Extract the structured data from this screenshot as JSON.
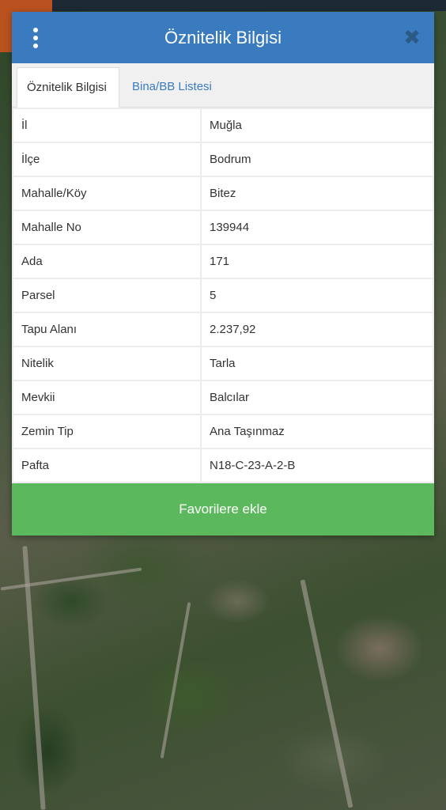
{
  "dialog": {
    "title": "Öznitelik Bilgisi",
    "menu_icon": "more-vertical-icon",
    "close_icon": "close-icon",
    "close_glyph": "✖"
  },
  "tabs": [
    {
      "label": "Öznitelik Bilgisi",
      "active": true
    },
    {
      "label": "Bina/BB Listesi",
      "active": false
    }
  ],
  "attributes": [
    {
      "key": "İl",
      "value": "Muğla"
    },
    {
      "key": "İlçe",
      "value": "Bodrum"
    },
    {
      "key": "Mahalle/Köy",
      "value": "Bitez"
    },
    {
      "key": "Mahalle No",
      "value": "139944"
    },
    {
      "key": "Ada",
      "value": "171"
    },
    {
      "key": "Parsel",
      "value": "5"
    },
    {
      "key": "Tapu Alanı",
      "value": "2.237,92"
    },
    {
      "key": "Nitelik",
      "value": "Tarla"
    },
    {
      "key": "Mevkii",
      "value": "Balcılar"
    },
    {
      "key": "Zemin Tip",
      "value": "Ana Taşınmaz"
    },
    {
      "key": "Pafta",
      "value": "N18-C-23-A-2-B"
    }
  ],
  "footer": {
    "favorite_label": "Favorilere ekle"
  },
  "colors": {
    "header": "#3a7bbf",
    "favorite_button": "#5cb85c",
    "tab_link": "#3a7bbf"
  }
}
